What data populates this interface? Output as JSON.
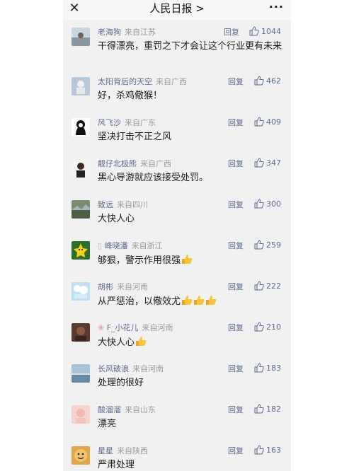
{
  "header": {
    "title": "人民日报 >",
    "close_icon": "close-icon",
    "more_icon": "more-dots-icon"
  },
  "reply_label": "回复",
  "comments": [
    {
      "user": "老海狗",
      "location": "来自江苏",
      "likes": "1044",
      "text": "干得漂亮，重罚之下才会让这个行业更有未来"
    },
    {
      "user": "太阳背后的天空",
      "location": "来自广西",
      "likes": "462",
      "text": "好，杀鸡儆猴！"
    },
    {
      "user": "风飞沙",
      "location": "来自广东",
      "likes": "409",
      "text": "坚决打击不正之风"
    },
    {
      "user": "靓仔北极熊",
      "location": "来自广西",
      "likes": "347",
      "text": "黑心导游就应该接受处罚。"
    },
    {
      "user": "致远",
      "location": "来自四川",
      "likes": "300",
      "text": "大快人心"
    },
    {
      "user": "峰晓潘",
      "location": "来自浙江",
      "likes": "259",
      "text": "够狠，警示作用很强"
    },
    {
      "user": "胡彬",
      "location": "来自河南",
      "likes": "222",
      "text": "从严惩治，以儆效尤"
    },
    {
      "user": "F_小花儿",
      "location": "来自河南",
      "likes": "210",
      "text": "大快人心"
    },
    {
      "user": "长风破浪",
      "location": "来自河南",
      "likes": "183",
      "text": "处理的很好"
    },
    {
      "user": "酸溜溜",
      "location": "来自山东",
      "likes": "182",
      "text": "漂亮"
    },
    {
      "user": "星星",
      "location": "来自陕西",
      "likes": "163",
      "text": "严肃处理"
    }
  ],
  "colors": {
    "background": "#f1f1f1",
    "username": "#5b6b8c",
    "location": "#9a9a9a",
    "text": "#1a1a1a"
  }
}
